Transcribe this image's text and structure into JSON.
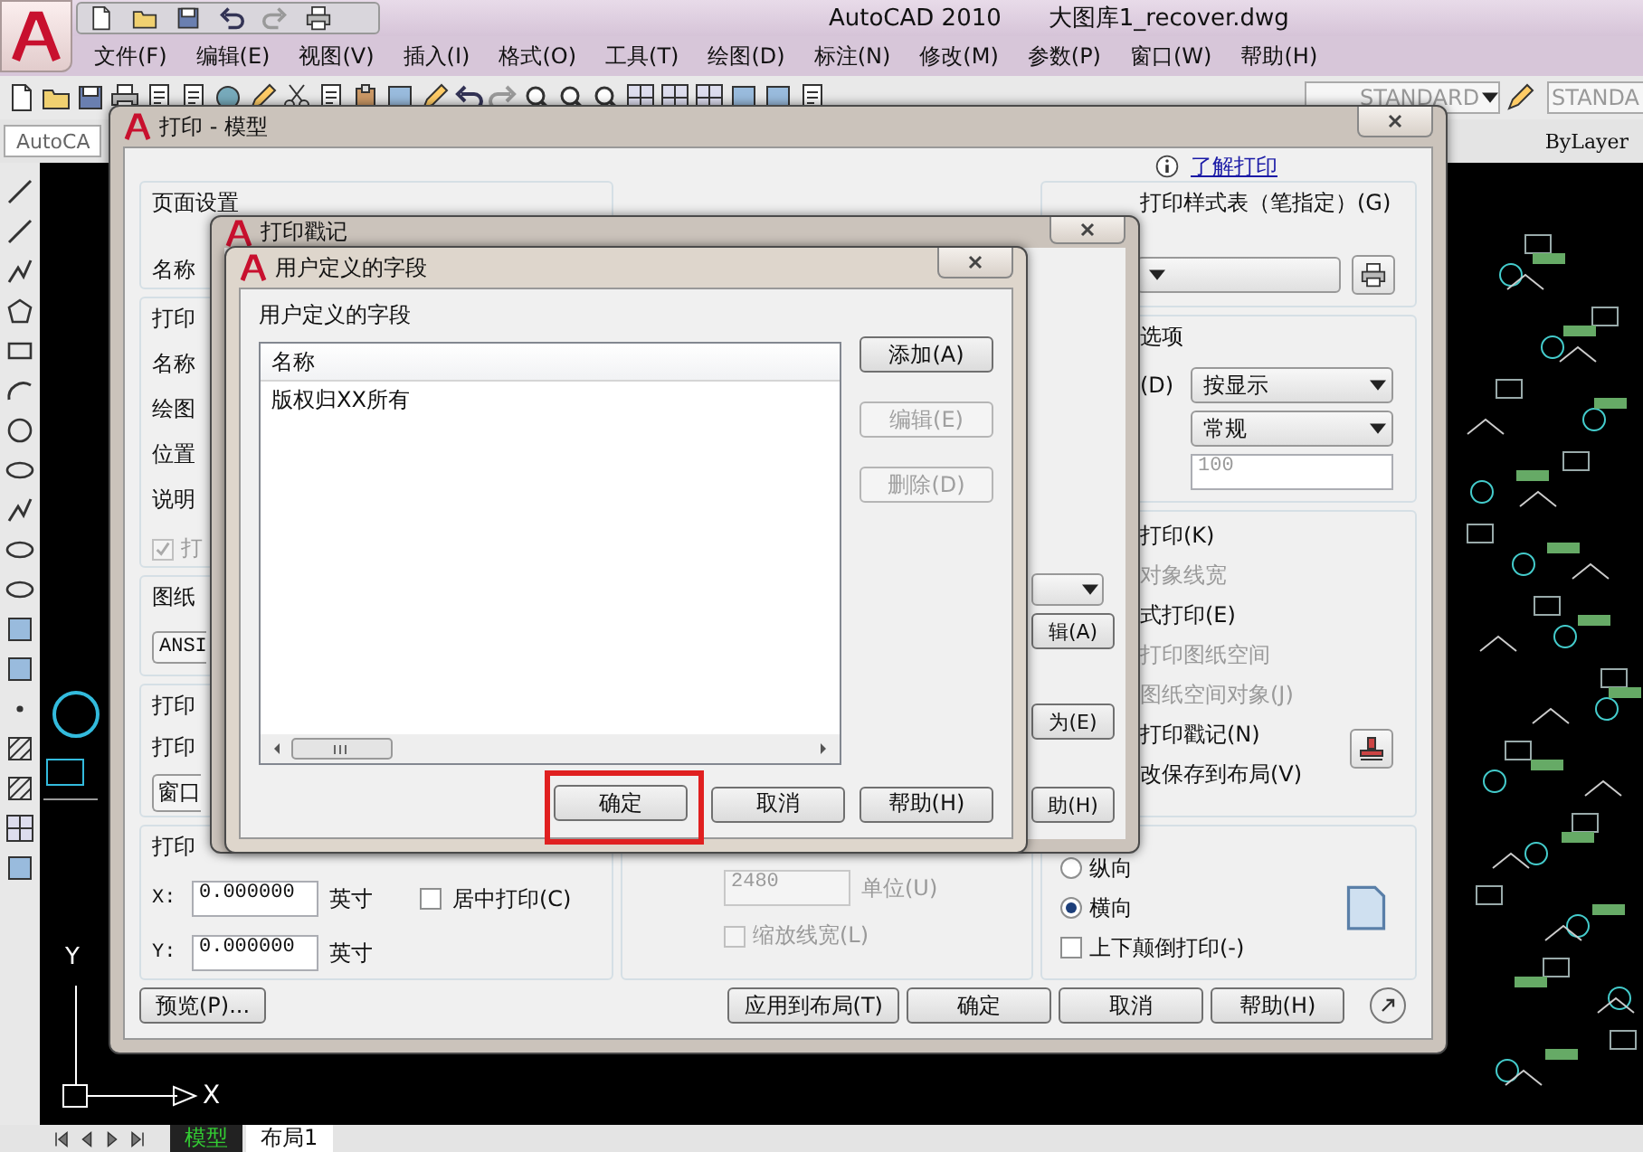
{
  "app": {
    "title": "AutoCAD 2010",
    "file": "大图库1_recover.dwg"
  },
  "menu": [
    "文件(F)",
    "编辑(E)",
    "视图(V)",
    "插入(I)",
    "格式(O)",
    "工具(T)",
    "绘图(D)",
    "标注(N)",
    "修改(M)",
    "参数(P)",
    "窗口(W)",
    "帮助(H)"
  ],
  "toolbar": {
    "text_style": "STANDARD",
    "dim_style": "STANDA",
    "workspace": "AutoCA",
    "linetype": "ByLayer"
  },
  "drawing": {
    "axis_y": "Y",
    "axis_x": "X"
  },
  "layout_tabs": [
    {
      "label": "模型",
      "selected": true
    },
    {
      "label": "布局1",
      "selected": false
    }
  ],
  "print_dialog": {
    "title": "打印 - 模型",
    "help_link": "了解打印",
    "page_setup": {
      "legend": "页面设置",
      "name_label": "名称"
    },
    "printer": {
      "legend": "打印",
      "labels": [
        "名称",
        "绘图",
        "位置",
        "说明"
      ],
      "checkbox": {
        "label": "打",
        "checked": true,
        "disabled": true
      }
    },
    "paper": {
      "legend": "图纸",
      "value": "ANSI"
    },
    "area": {
      "legend": "打印",
      "label": "打印",
      "value": "窗口"
    },
    "offset": {
      "legend": "打印",
      "x_label": "X:",
      "x_value": "0.000000",
      "x_unit": "英寸",
      "y_label": "Y:",
      "y_value": "0.000000",
      "y_unit": "英寸",
      "center": {
        "label": "居中打印(C)",
        "checked": false
      }
    },
    "scale": {
      "value": "2480",
      "disabled": true,
      "unit": "单位(U)",
      "lineweights": {
        "label": "缩放线宽(L)",
        "checked": false,
        "disabled": true
      }
    },
    "style_table": {
      "legend": "打印样式表（笔指定）(G)"
    },
    "viewport": {
      "legend": "选项",
      "shade_label": "(D)",
      "shade": "按显示",
      "quality": "常规",
      "dpi": "100"
    },
    "options": [
      {
        "label": "打印(K)",
        "disabled": false
      },
      {
        "label": "对象线宽",
        "disabled": true
      },
      {
        "label": "式打印(E)",
        "disabled": false
      },
      {
        "label": "打印图纸空间",
        "disabled": true
      },
      {
        "label": "图纸空间对象(J)",
        "disabled": true
      },
      {
        "label": "打印戳记(N)",
        "disabled": false
      },
      {
        "label": "改保存到布局(V)",
        "disabled": false
      }
    ],
    "orientation": [
      {
        "label": "纵向",
        "selected": false
      },
      {
        "label": "横向",
        "selected": true
      }
    ],
    "upside_down": {
      "label": "上下颠倒打印(-)",
      "checked": false
    },
    "buttons": {
      "preview": "预览(P)...",
      "apply": "应用到布局(T)",
      "ok": "确定",
      "cancel": "取消",
      "help": "帮助(H)"
    }
  },
  "stamp_dialog": {
    "title": "打印戳记",
    "buttons": [
      "辑(A)",
      "为(E)",
      "助(H)"
    ]
  },
  "fields_dialog": {
    "title": "用户定义的字段",
    "legend": "用户定义的字段",
    "column": "名称",
    "rows": [
      {
        "label": "版权归XX所有",
        "selected": false
      }
    ],
    "side_buttons": [
      {
        "label": "添加(A)",
        "disabled": false
      },
      {
        "label": "编辑(E)",
        "disabled": true
      },
      {
        "label": "删除(D)",
        "disabled": true
      }
    ],
    "buttons": [
      {
        "label": "确定",
        "highlighted": true
      },
      {
        "label": "取消",
        "highlighted": false
      },
      {
        "label": "帮助(H)",
        "highlighted": false
      }
    ]
  }
}
